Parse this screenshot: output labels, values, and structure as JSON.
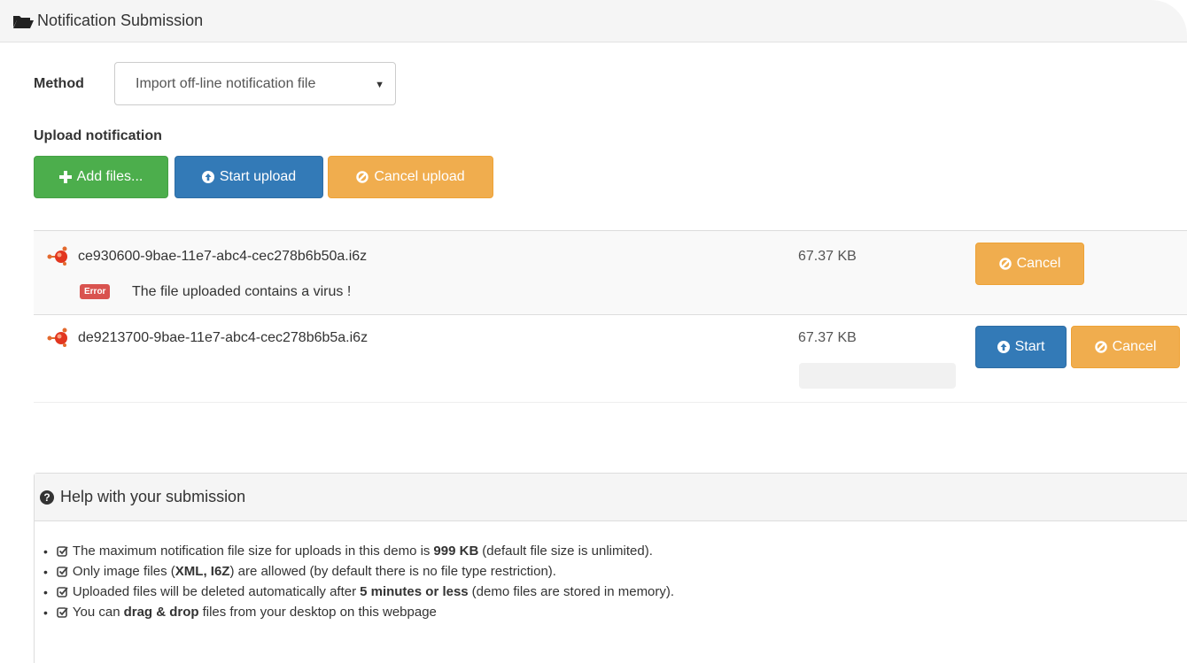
{
  "panel": {
    "title": "Notification Submission",
    "icon": "folder-open-icon"
  },
  "method": {
    "label": "Method",
    "selected": "Import off-line notification file"
  },
  "upload": {
    "label": "Upload notification",
    "add_files": "Add files...",
    "start_upload": "Start upload",
    "cancel_upload": "Cancel upload"
  },
  "files": [
    {
      "name": "ce930600-9bae-11e7-abc4-cec278b6b50a.i6z",
      "size": "67.37 KB",
      "error_label": "Error",
      "error_text": "The file uploaded contains a virus !",
      "cancel": "Cancel"
    },
    {
      "name": "de9213700-9bae-11e7-abc4-cec278b6b5a.i6z",
      "size": "67.37 KB",
      "start": "Start",
      "cancel": "Cancel",
      "progress": 0
    }
  ],
  "help": {
    "title": "Help with your submission",
    "items": [
      {
        "pre": "The maximum notification file size for uploads in this demo is",
        "bold": "999 KB",
        "post": "(default file size is unlimited)."
      },
      {
        "pre": "Only image files (",
        "bold": "XML, I6Z",
        "post": ") are allowed (by default there is no file type restriction)."
      },
      {
        "pre": "Uploaded files will be deleted automatically after",
        "bold": "5 minutes or less",
        "post": "(demo files are stored in memory)."
      },
      {
        "pre": "You can",
        "bold": "drag & drop",
        "post": "files from your desktop on this webpage"
      }
    ]
  },
  "colors": {
    "success": "#4cae4c",
    "primary": "#337ab7",
    "warning": "#f0ad4e",
    "danger": "#d9534f"
  }
}
